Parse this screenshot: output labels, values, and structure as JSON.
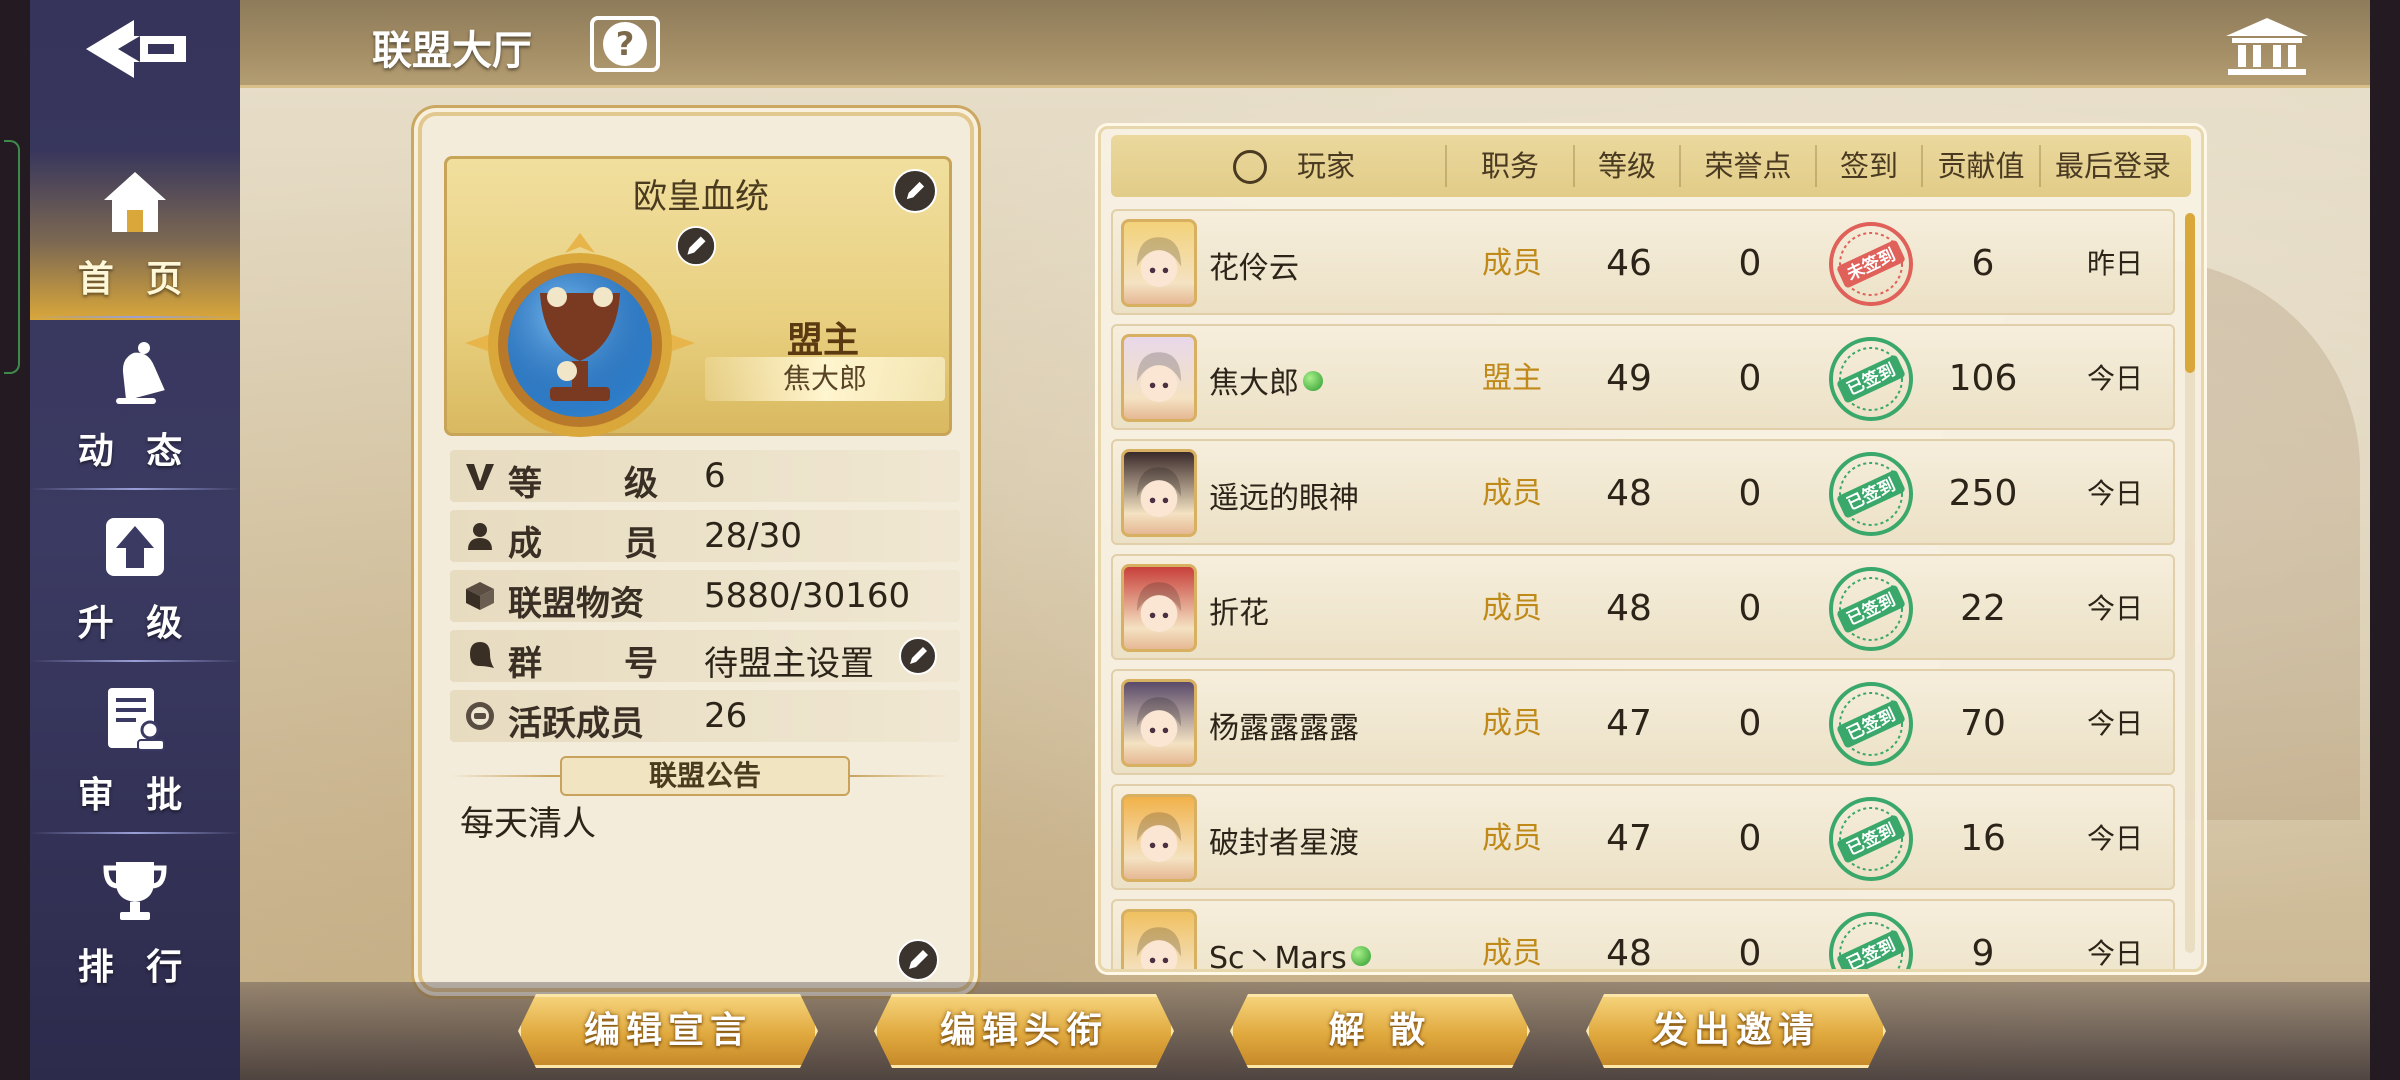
{
  "header": {
    "title": "联盟大厅",
    "help_icon": "help-icon",
    "right_icon": "bank-icon"
  },
  "sidebar": {
    "items": [
      {
        "label": "首 页",
        "icon": "home-icon",
        "active": true
      },
      {
        "label": "动 态",
        "icon": "bell-icon",
        "active": false
      },
      {
        "label": "升 级",
        "icon": "upgrade-icon",
        "active": false
      },
      {
        "label": "审 批",
        "icon": "approval-icon",
        "active": false
      },
      {
        "label": "排 行",
        "icon": "trophy-icon",
        "active": false
      }
    ]
  },
  "union": {
    "name": "欧皇血统",
    "role_title": "盟主",
    "leader_name": "焦大郎",
    "stats": [
      {
        "icon": "vip-icon",
        "key_chars": [
          "等",
          "级"
        ],
        "value": "6"
      },
      {
        "icon": "person-icon",
        "key_chars": [
          "成",
          "员"
        ],
        "value": "28/30"
      },
      {
        "icon": "box-icon",
        "key_chars": [
          "联盟物资"
        ],
        "value": "5880/30160"
      },
      {
        "icon": "chat-icon",
        "key_chars": [
          "群",
          "号"
        ],
        "value": "待盟主设置"
      },
      {
        "icon": "activity-icon",
        "key_chars": [
          "活跃成员"
        ],
        "value": "26"
      }
    ],
    "notice_title": "联盟公告",
    "notice_text": "每天清人"
  },
  "table": {
    "headers": [
      "玩家",
      "职务",
      "等级",
      "荣誉点",
      "签到",
      "贡献值",
      "最后登录"
    ],
    "rows": [
      {
        "name": "花伶云",
        "online": false,
        "rank": "成员",
        "level": "46",
        "honor": "0",
        "signed": false,
        "contribution": "6",
        "last_login": "昨日",
        "avatar_color": "#f3d27a"
      },
      {
        "name": "焦大郎",
        "online": true,
        "rank": "盟主",
        "level": "49",
        "honor": "0",
        "signed": true,
        "contribution": "106",
        "last_login": "今日",
        "avatar_color": "#e8d8ea"
      },
      {
        "name": "遥远的眼神",
        "online": false,
        "rank": "成员",
        "level": "48",
        "honor": "0",
        "signed": true,
        "contribution": "250",
        "last_login": "今日",
        "avatar_color": "#3a2a2a"
      },
      {
        "name": "折花",
        "online": false,
        "rank": "成员",
        "level": "48",
        "honor": "0",
        "signed": true,
        "contribution": "22",
        "last_login": "今日",
        "avatar_color": "#c8403a"
      },
      {
        "name": "杨露露露露",
        "online": false,
        "rank": "成员",
        "level": "47",
        "honor": "0",
        "signed": true,
        "contribution": "70",
        "last_login": "今日",
        "avatar_color": "#5a4a6a"
      },
      {
        "name": "破封者星渡",
        "online": false,
        "rank": "成员",
        "level": "47",
        "honor": "0",
        "signed": true,
        "contribution": "16",
        "last_login": "今日",
        "avatar_color": "#f2b24a"
      },
      {
        "name": "Sc丶Mars",
        "online": true,
        "rank": "成员",
        "level": "48",
        "honor": "0",
        "signed": true,
        "contribution": "9",
        "last_login": "今日",
        "avatar_color": "#f0c060"
      }
    ],
    "stamp_signed": "已签到",
    "stamp_unsigned": "未签到"
  },
  "actions": [
    {
      "label": "编辑宣言"
    },
    {
      "label": "编辑头衔"
    },
    {
      "label": "解 散"
    },
    {
      "label": "发出邀请"
    }
  ],
  "colors": {
    "accent_gold": "#d9a73a",
    "rank_text": "#c08a1a",
    "stamp_green": "#3aa86a",
    "stamp_red": "#e0605a"
  }
}
